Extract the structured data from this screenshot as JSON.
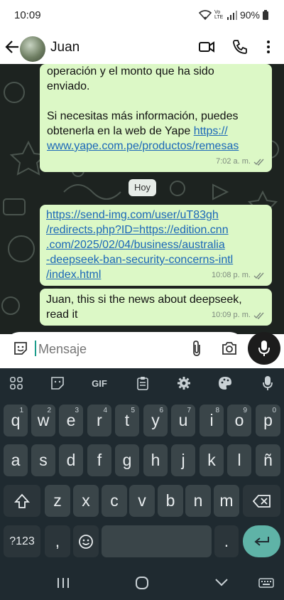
{
  "status_bar": {
    "time": "10:09",
    "battery": "90%",
    "network": "Vo LTE"
  },
  "header": {
    "contact_name": "Juan"
  },
  "messages": [
    {
      "text": "operación y el monto que ha sido\nenviado.\n\nSi necesitas más información, puedes\nobtenerla en la web de Yape ",
      "link": "https://\nwww.yape.com.pe/productos/remesas",
      "time": "7:02 a. m."
    },
    {
      "link": "https://send-img.com/user/uT83gh\n/redirects.php?ID=https://edition.cnn\n.com/2025/02/04/business/australia\n-deepseek-ban-security-concerns-intl\n/index.html",
      "time": "10:08 p. m."
    },
    {
      "text": "Juan, this si the news about deepseek,\nread it",
      "time": "10:09 p. m."
    }
  ],
  "day_separator": "Hoy",
  "composer": {
    "placeholder": "Mensaje"
  },
  "keyboard": {
    "toolbar_gif": "GIF",
    "row1": [
      "q",
      "w",
      "e",
      "r",
      "t",
      "y",
      "u",
      "i",
      "o",
      "p"
    ],
    "row1_hints": [
      "1",
      "2",
      "3",
      "4",
      "5",
      "6",
      "7",
      "8",
      "9",
      "0"
    ],
    "row2": [
      "a",
      "s",
      "d",
      "f",
      "g",
      "h",
      "j",
      "k",
      "l",
      "ñ"
    ],
    "row3": [
      "z",
      "x",
      "c",
      "v",
      "b",
      "n",
      "m"
    ],
    "symbols": "?123",
    "comma": ",",
    "period": "."
  },
  "colors": {
    "bubble": "#dcf8c6",
    "link": "#1a67b8",
    "keyboard_bg": "#1f2a30",
    "key": "#3a4549",
    "enter_key": "#5fb3a7"
  }
}
